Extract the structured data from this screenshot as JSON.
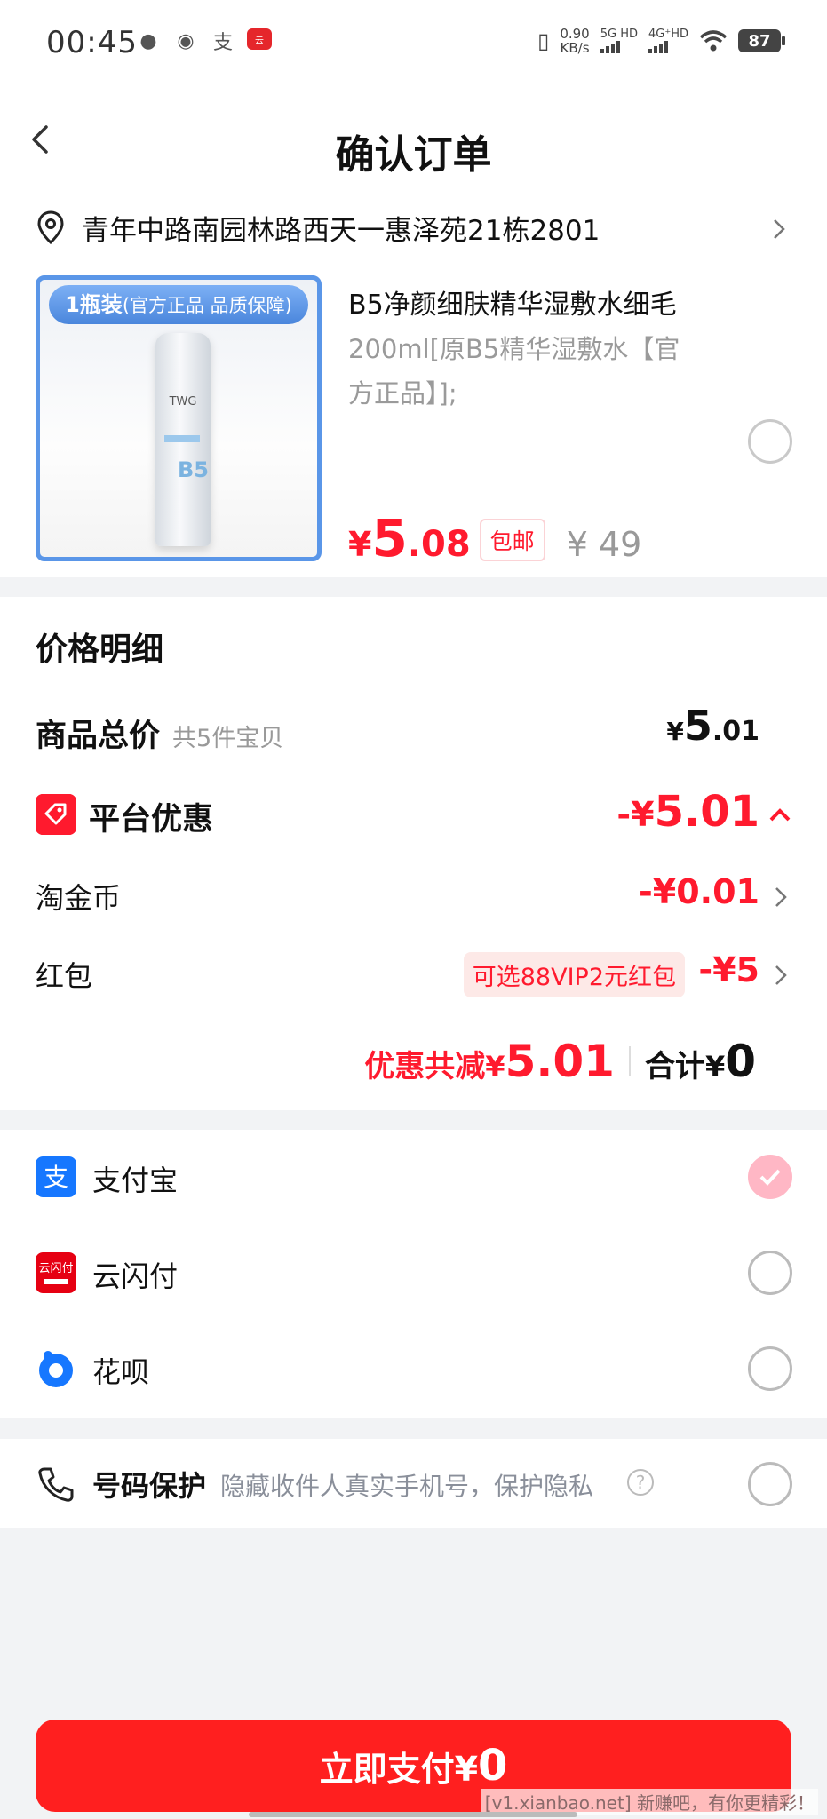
{
  "status_bar": {
    "time": "00:45",
    "net_speed_top": "0.90",
    "net_speed_bottom": "KB/s",
    "sim1": "5G HD",
    "sim2": "4G⁺HD",
    "battery": "87",
    "icons": [
      "wechat-icon",
      "chat-bubble-icon",
      "alipay-icon",
      "unionpay-icon",
      "vibrate-icon",
      "wifi-icon"
    ]
  },
  "header": {
    "title": "确认订单"
  },
  "address": {
    "text": "青年中路南园林路西天一惠泽苑21栋2801"
  },
  "product": {
    "image_banner_main": "1瓶装",
    "image_banner_sub": "(官方正品 品质保障)",
    "bottle_brand": "TWG",
    "bottle_mark": "B5",
    "title": "B5净颜细肤精华湿敷水细毛",
    "sku": "200ml[原B5精华湿敷水【官方正品】];",
    "price_currency": "¥",
    "price_int": "5",
    "price_dec": ".08",
    "free_shipping": "包邮",
    "original_price": "¥ 49"
  },
  "price_detail": {
    "title": "价格明细",
    "goods_total_label": "商品总价",
    "goods_total_sub": "共5件宝贝",
    "goods_total_currency": "¥",
    "goods_total_int": "5",
    "goods_total_dec": ".01",
    "platform_discount_label": "平台优惠",
    "platform_discount_prefix": "-¥",
    "platform_discount_value": "5.01",
    "taojinbi_label": "淘金币",
    "taojinbi_value": "-¥0.01",
    "redpacket_label": "红包",
    "redpacket_option": "可选88VIP2元红包",
    "redpacket_value": "-¥5",
    "discount_total_label": "优惠共减",
    "discount_total_currency": "¥",
    "discount_total_value": "5.01",
    "sum_label": "合计",
    "sum_currency": "¥",
    "sum_value": "0"
  },
  "payment": {
    "methods": [
      {
        "label": "支付宝",
        "icon": "alipay-icon",
        "color": "#1677ff",
        "selected": true
      },
      {
        "label": "云闪付",
        "icon": "unionpay-icon",
        "color": "#e60012",
        "selected": false
      },
      {
        "label": "花呗",
        "icon": "huabei-icon",
        "color": "#1677ff",
        "selected": false
      }
    ]
  },
  "privacy": {
    "label": "号码保护",
    "description": "隐藏收件人真实手机号，保护隐私"
  },
  "pay_button": {
    "label": "立即支付¥",
    "amount": "0"
  },
  "watermark": "[v1.xianbao.net] 新赚吧，有你更精彩！",
  "colors": {
    "accent_red": "#ff1a2e",
    "pay_button": "#ff1f1f",
    "selected_radio": "#ffb7c5"
  }
}
